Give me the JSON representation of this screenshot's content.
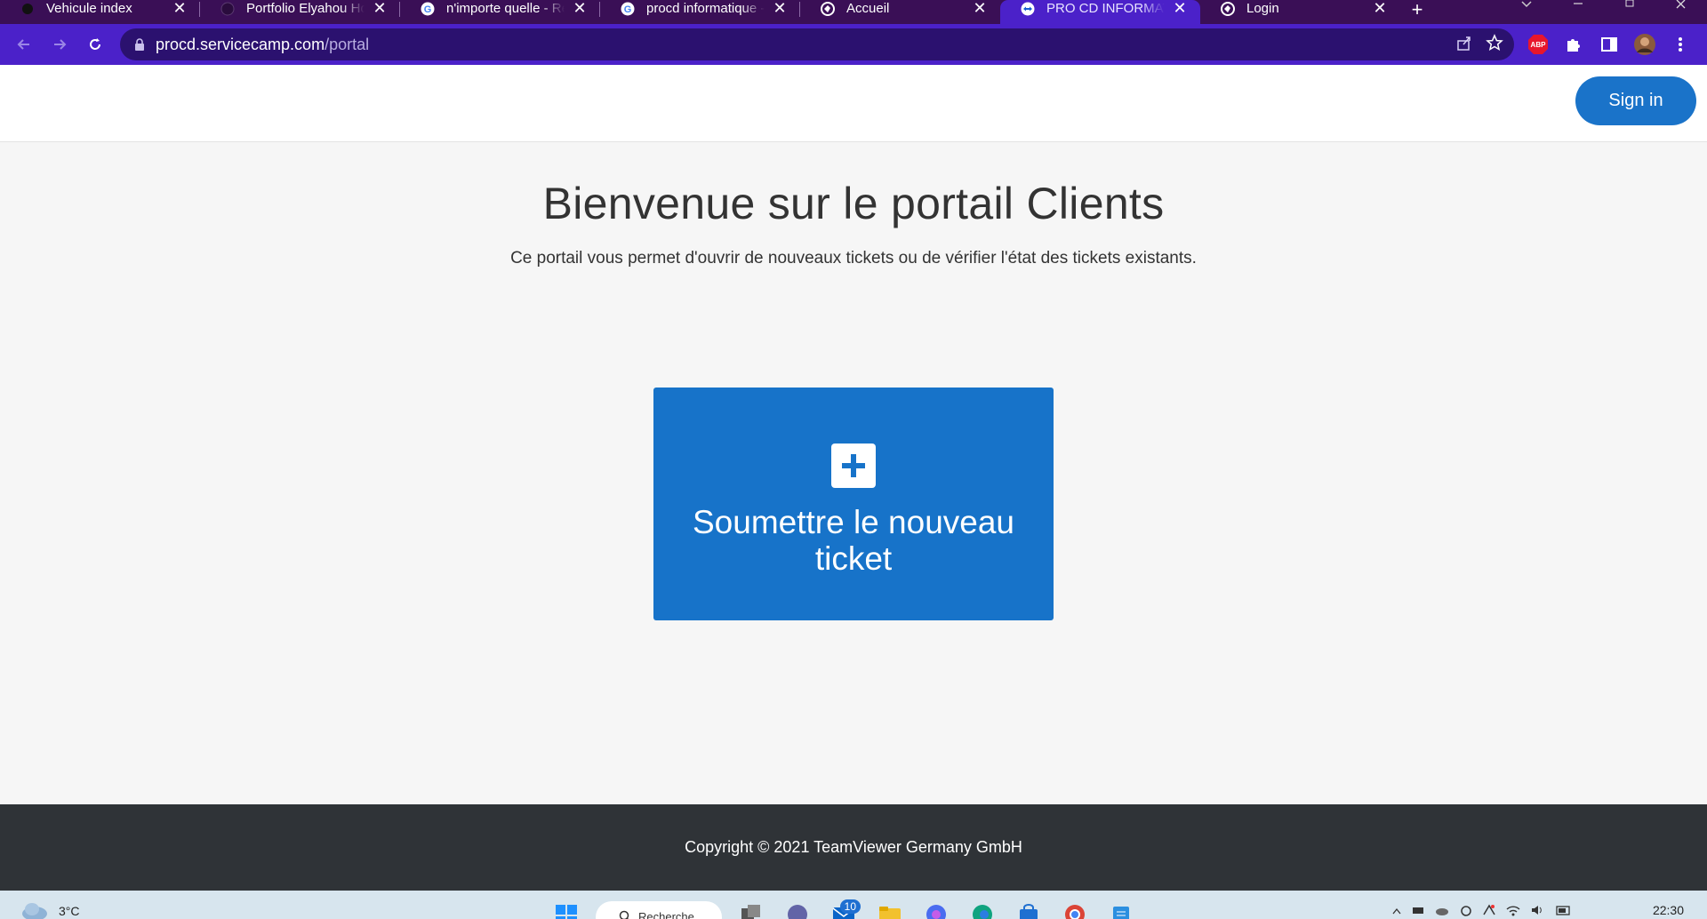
{
  "browser": {
    "tabs": [
      {
        "title": "Vehicule index",
        "favicon": "dark-circle-icon"
      },
      {
        "title": "Portfolio Elyahou Houri",
        "favicon": "globe-dark-icon"
      },
      {
        "title": "n'importe quelle - Recherche",
        "favicon": "google-icon"
      },
      {
        "title": "procd informatique - Recherche",
        "favicon": "google-icon"
      },
      {
        "title": "Accueil",
        "favicon": "globe-icon"
      },
      {
        "title": "PRO CD INFORMATIQUE",
        "favicon": "teamviewer-icon",
        "active": true
      },
      {
        "title": "Login",
        "favicon": "globe-icon"
      }
    ],
    "new_tab": "+",
    "url_host": "procd.servicecamp.com",
    "url_path": "/portal",
    "ext_abp": "ABP"
  },
  "header": {
    "sign_in": "Sign in"
  },
  "main": {
    "headline": "Bienvenue sur le portail Clients",
    "subline": "Ce portail vous permet d'ouvrir de nouveaux tickets ou de vérifier l'état des tickets existants.",
    "submit_ticket": "Soumettre le nouveau ticket"
  },
  "footer": {
    "copyright": "Copyright © 2021 TeamViewer Germany GmbH"
  },
  "taskbar": {
    "temperature": "3°C",
    "search_placeholder": "Recherche",
    "mail_badge": "10",
    "clock": "22:30"
  },
  "colors": {
    "tabstrip": "#3a0f56",
    "toolbar": "#4b21c9",
    "accent": "#1773c9",
    "footer": "#2f3337"
  }
}
